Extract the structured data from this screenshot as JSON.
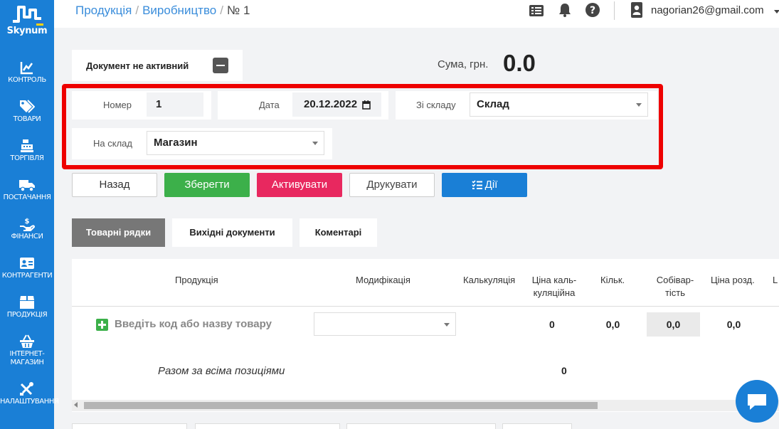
{
  "app": {
    "name": "Skynum"
  },
  "sidebar": {
    "items": [
      {
        "id": "control",
        "label": "КОНТРОЛЬ",
        "icon": "chart-line-icon"
      },
      {
        "id": "goods",
        "label": "ТОВАРИ",
        "icon": "tags-icon"
      },
      {
        "id": "trade",
        "label": "ТОРГІВЛЯ",
        "icon": "cash-register-icon"
      },
      {
        "id": "supply",
        "label": "ПОСТАЧАННЯ",
        "icon": "truck-icon"
      },
      {
        "id": "finance",
        "label": "ФІНАНСИ",
        "icon": "hand-dollar-icon"
      },
      {
        "id": "contractors",
        "label": "КОНТРАГЕНТИ",
        "icon": "address-card-icon"
      },
      {
        "id": "products",
        "label": "ПРОДУКЦІЯ",
        "icon": "box-icon"
      },
      {
        "id": "eshop",
        "label": "ІНТЕРНЕТ-",
        "label2": "МАГАЗИН",
        "icon": "shopping-basket-icon"
      },
      {
        "id": "settings",
        "label": "НАЛАШТУВАННЯ",
        "icon": "tools-icon"
      }
    ]
  },
  "header": {
    "breadcrumb": [
      "Продукція",
      "Виробництво"
    ],
    "current": "№ 1",
    "user_email": "nagorian26@gmail.com"
  },
  "document": {
    "status_label": "Документ не активний",
    "sum_label": "Сума, грн.",
    "sum_value": "0.0"
  },
  "form": {
    "number_label": "Номер",
    "number_value": "1",
    "date_label": "Дата",
    "date_value": "20.12.2022",
    "from_label": "Зі складу",
    "from_value": "Склад",
    "to_label": "На склад",
    "to_value": "Магазин"
  },
  "actions": {
    "back": "Назад",
    "save": "Зберегти",
    "activate": "Активувати",
    "print": "Друкувати",
    "actions": "Дії"
  },
  "tabs": [
    "Товарні рядки",
    "Вихідні документи",
    "Коментарі"
  ],
  "table": {
    "headers": {
      "product": "Продукція",
      "modification": "Модифікація",
      "calculation": "Калькуляція",
      "calc_price_1": "Ціна каль-",
      "calc_price_2": "куляційна",
      "qty": "Кільк.",
      "cost_1": "Собівар-",
      "cost_2": "тість",
      "retail": "Ціна розд."
    },
    "add_placeholder": "Введіть код або назву товару",
    "row": {
      "calc_price": "0",
      "qty": "0,0",
      "cost": "0,0",
      "retail": "0,0"
    },
    "total_label": "Разом за всіма позиціями",
    "total_value": "0"
  },
  "colors": {
    "primary": "#1a7fd6",
    "success": "#3cb04a",
    "danger": "#e8285f",
    "highlight": "#ee0000"
  }
}
